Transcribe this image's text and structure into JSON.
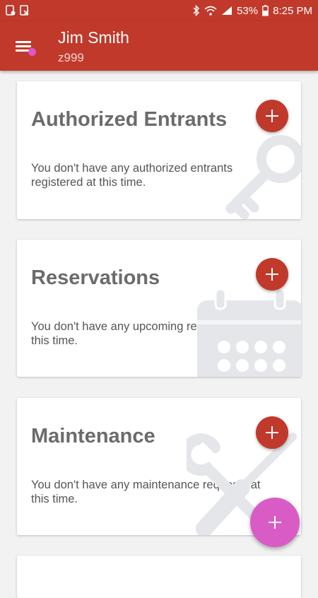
{
  "status_bar": {
    "battery": "53%",
    "time": "8:25 PM",
    "icons": [
      "notification-icon",
      "notification-x-icon",
      "bluetooth-icon",
      "wifi-icon",
      "signal-icon",
      "battery-icon"
    ]
  },
  "header": {
    "name": "Jim Smith",
    "user_id": "z999",
    "menu_icon": "menu-icon",
    "colors": {
      "primary": "#c0392b",
      "accent": "#d95cc6"
    }
  },
  "cards": [
    {
      "title": "Authorized Entrants",
      "text": "You don't have any authorized entrants registered at this time.",
      "icon": "key-icon"
    },
    {
      "title": "Reservations",
      "text": "You don't have any upcoming reservations at this time.",
      "icon": "calendar-icon"
    },
    {
      "title": "Maintenance",
      "text": "You don't have any maintenance requests at this time.",
      "icon": "wrench-screwdriver-icon"
    }
  ],
  "fab": {
    "icon": "plus-icon"
  }
}
